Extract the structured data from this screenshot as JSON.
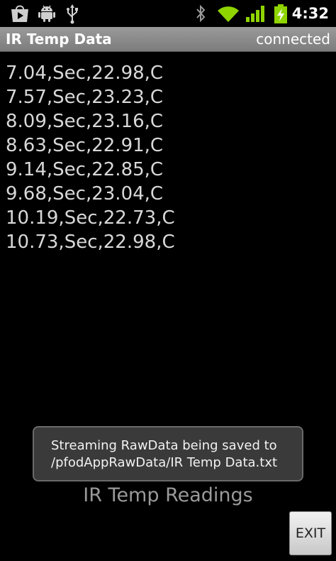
{
  "status_bar": {
    "time": "4:32",
    "icons": [
      "play-store-icon",
      "android-debug-icon",
      "usb-icon",
      "bluetooth-icon",
      "wifi-icon",
      "signal-icon",
      "battery-charging-icon"
    ],
    "accent_color": "#8fd400"
  },
  "title_bar": {
    "title": "IR Temp Data",
    "connection_status": "connected"
  },
  "data_lines": [
    "7.04,Sec,22.98,C",
    "7.57,Sec,23.23,C",
    "8.09,Sec,23.16,C",
    "8.63,Sec,22.91,C",
    "9.14,Sec,22.85,C",
    "9.68,Sec,23.04,C",
    "10.19,Sec,22.73,C",
    "10.73,Sec,22.98,C"
  ],
  "toast": {
    "line1": "Streaming RawData being saved to",
    "line2": "/pfodAppRawData/IR Temp Data.txt"
  },
  "footer": {
    "label": "IR Temp Readings",
    "exit_label": "EXIT"
  }
}
